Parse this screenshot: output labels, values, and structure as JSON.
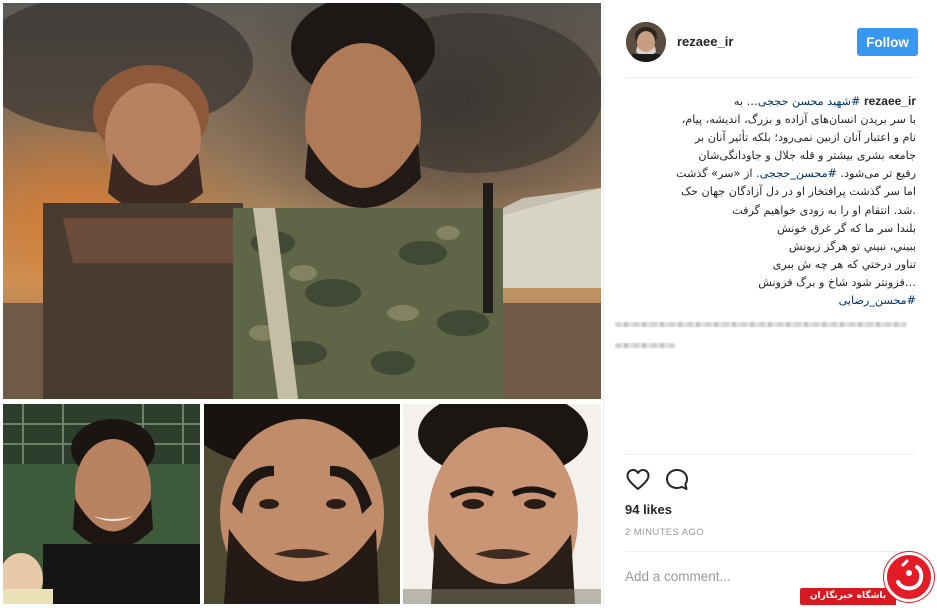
{
  "post": {
    "username": "rezaee_ir",
    "follow_label": "Follow",
    "caption": {
      "username": "rezaee_ir",
      "line1_start": "… به  ",
      "line1_tag": "#شهید محسن حججی",
      "line2": "با سر بریدن انسان‌های آزاده و بزرگ، اندیشه، پیام،",
      "line3": "نام و اعتبار آنان ازبین نمی‌رود؛ بلکه تأثیر آنان بر",
      "line4": "جامعه بشری بیشتر و قله جلال و جاودانگی‌شان",
      "line5_start": "رفیع تر می‌شود. ",
      "line5_tag": "#محسن_حججی",
      "line5_end": ". از «سر» گذشت",
      "line6": "اما سر گذشت پرافتخار او در دل آزادگان جهان حک",
      "line7": ".شد. انتقام او را به زودی خواهیم گرفت",
      "line8": "بلندا سر ما که گر غرق خونش",
      "line9": "ببيني، نبيني تو هرگز زبونش",
      "line10": "تناور درختي که هر چه ش ببری",
      "line11": "…فزونتر شود شاخ و برگ فزونش",
      "line12_tag": "#محسن_رضایی"
    },
    "likes": "94 likes",
    "time": "2 MINUTES AGO",
    "comment_placeholder": "Add a comment..."
  },
  "icons": {
    "like": "heart-icon",
    "comment": "comment-bubble-icon",
    "watermark": "club-logo-icon"
  },
  "watermark": {
    "text": "باشگاه خبرنگاران"
  },
  "colors": {
    "follow_button": "#3897f0",
    "hashtag": "#003569",
    "watermark_red": "#d81922",
    "muted_text": "#999999"
  }
}
